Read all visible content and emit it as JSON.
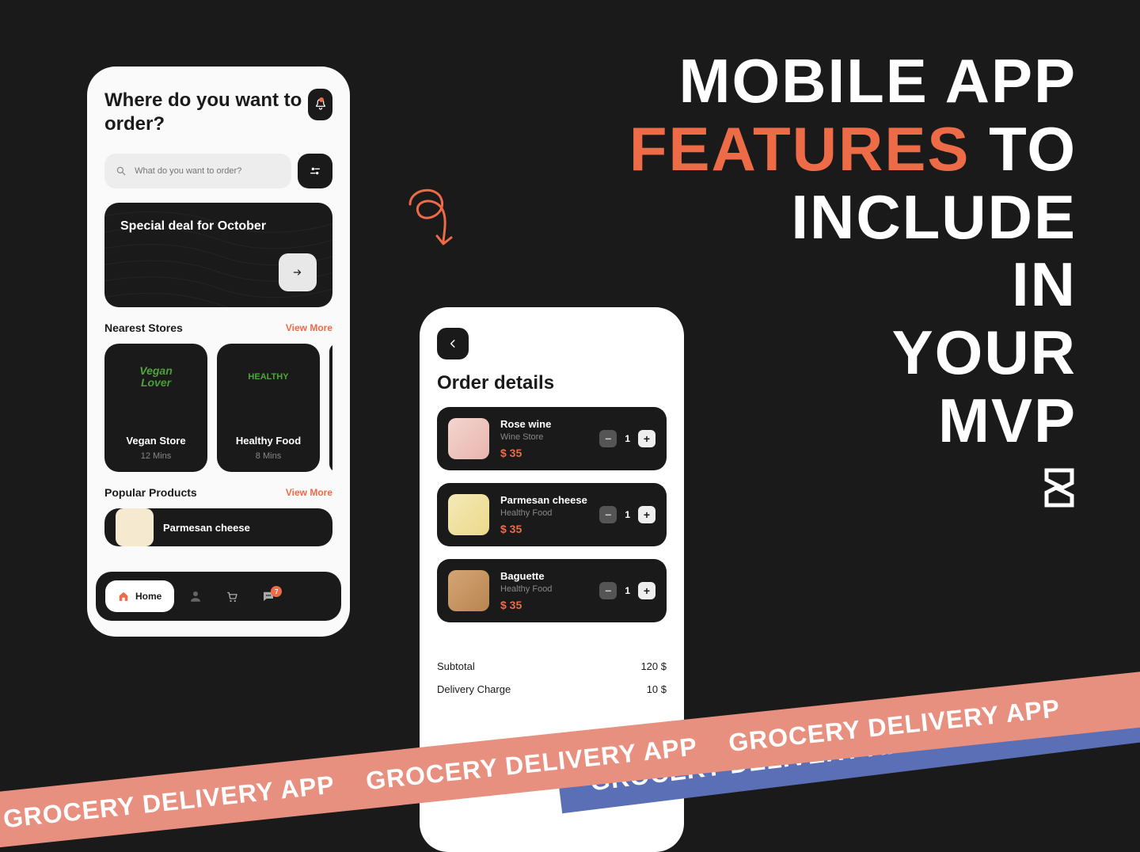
{
  "headline": {
    "line1": "MOBILE APP",
    "line2_accent": "FEATURES",
    "line2_rest": " TO",
    "line3": "INCLUDE",
    "line4": "IN",
    "line5": "YOUR",
    "line6": "MVP"
  },
  "ribbon_text": "GROCERY DELIVERY APP",
  "phone1": {
    "heading": "Where do you want to order?",
    "search_placeholder": "What do you want to order?",
    "promo": "Special deal for October",
    "nearest_label": "Nearest Stores",
    "popular_label": "Popular Products",
    "view_more": "View More",
    "stores": [
      {
        "name": "Vegan Store",
        "time": "12 Mins",
        "logo_text": "Vegan Lover"
      },
      {
        "name": "Healthy Food",
        "time": "8 Mins",
        "logo_text": "HEALTHY"
      }
    ],
    "popular_product": "Parmesan cheese",
    "nav": {
      "home": "Home",
      "badge_count": "7"
    }
  },
  "phone2": {
    "title": "Order details",
    "items": [
      {
        "name": "Rose wine",
        "store": "Wine Store",
        "price": "$ 35",
        "qty": "1"
      },
      {
        "name": "Parmesan cheese",
        "store": "Healthy Food",
        "price": "$ 35",
        "qty": "1"
      },
      {
        "name": "Baguette",
        "store": "Healthy Food",
        "price": "$ 35",
        "qty": "1"
      }
    ],
    "summary": {
      "subtotal_label": "Subtotal",
      "subtotal_value": "120 $",
      "delivery_label": "Delivery Charge",
      "delivery_value": "10 $"
    }
  }
}
